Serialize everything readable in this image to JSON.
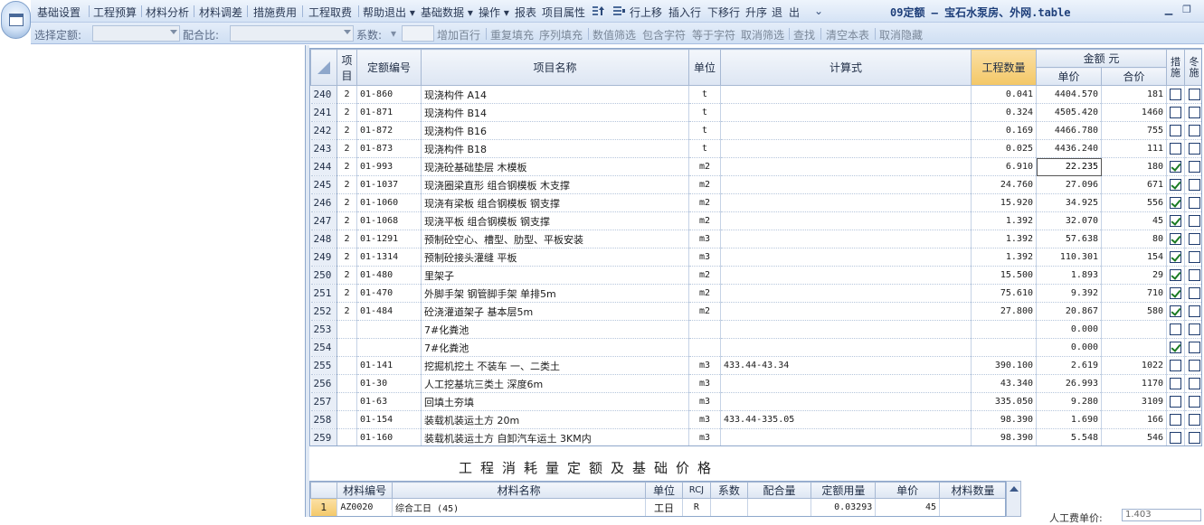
{
  "window_title": "09定额 — 宝石水泵房、外网.table",
  "menu": [
    "基础设置",
    "工程预算",
    "材料分析",
    "材料调差",
    "措施费用",
    "工程取费",
    "帮助退出 ▾",
    "基础数据 ▾",
    "操作 ▾",
    "报表",
    "项目属性",
    "行上移",
    "插入行",
    "下移行",
    "升序",
    "退",
    "出"
  ],
  "filterbar": {
    "select_quota_label": "选择定额:",
    "mix_ratio_label": "配合比:",
    "coef_label": "系数:",
    "actions": [
      "增加百行",
      "重复填充",
      "序列填充",
      "数值筛选",
      "包含字符",
      "等于字符",
      "取消筛选",
      "查找",
      "清空本表",
      "取消隐藏"
    ]
  },
  "grid": {
    "headers": {
      "item": "项目",
      "code": "定额编号",
      "name": "项目名称",
      "unit": "单位",
      "formula": "计算式",
      "qty": "工程数量",
      "amount": "金额 元",
      "unit_price": "单价",
      "total": "合价",
      "measure": "措施",
      "winter": "冬施"
    },
    "rows": [
      {
        "no": "240",
        "item": "2",
        "code": "01-860",
        "name": "现浇构件 A14",
        "unit": "t",
        "formula": "",
        "qty": "0.041",
        "price": "4404.570",
        "total": "181",
        "measure": false,
        "winter": false
      },
      {
        "no": "241",
        "item": "2",
        "code": "01-871",
        "name": "现浇构件 B14",
        "unit": "t",
        "formula": "",
        "qty": "0.324",
        "price": "4505.420",
        "total": "1460",
        "measure": false,
        "winter": false
      },
      {
        "no": "242",
        "item": "2",
        "code": "01-872",
        "name": "现浇构件 B16",
        "unit": "t",
        "formula": "",
        "qty": "0.169",
        "price": "4466.780",
        "total": "755",
        "measure": false,
        "winter": false
      },
      {
        "no": "243",
        "item": "2",
        "code": "01-873",
        "name": "现浇构件 B18",
        "unit": "t",
        "formula": "",
        "qty": "0.025",
        "price": "4436.240",
        "total": "111",
        "measure": false,
        "winter": false
      },
      {
        "no": "244",
        "item": "2",
        "code": "01-993",
        "name": "现浇砼基础垫层 木模板",
        "unit": "m2",
        "formula": "",
        "qty": "6.910",
        "price": "22.235",
        "total": "180",
        "measure": true,
        "winter": false,
        "selected": true
      },
      {
        "no": "245",
        "item": "2",
        "code": "01-1037",
        "name": "现浇圈梁直形 组合钢模板 木支撑",
        "unit": "m2",
        "formula": "",
        "qty": "24.760",
        "price": "27.096",
        "total": "671",
        "measure": true,
        "winter": false
      },
      {
        "no": "246",
        "item": "2",
        "code": "01-1060",
        "name": "现浇有梁板 组合钢模板 钢支撑",
        "unit": "m2",
        "formula": "",
        "qty": "15.920",
        "price": "34.925",
        "total": "556",
        "measure": true,
        "winter": false
      },
      {
        "no": "247",
        "item": "2",
        "code": "01-1068",
        "name": "现浇平板 组合钢模板 钢支撑",
        "unit": "m2",
        "formula": "",
        "qty": "1.392",
        "price": "32.070",
        "total": "45",
        "measure": true,
        "winter": false
      },
      {
        "no": "248",
        "item": "2",
        "code": "01-1291",
        "name": "预制砼空心、槽型、肋型、平板安装",
        "unit": "m3",
        "formula": "",
        "qty": "1.392",
        "price": "57.638",
        "total": "80",
        "measure": true,
        "winter": false
      },
      {
        "no": "249",
        "item": "2",
        "code": "01-1314",
        "name": "预制砼接头灌缝 平板",
        "unit": "m3",
        "formula": "",
        "qty": "1.392",
        "price": "110.301",
        "total": "154",
        "measure": true,
        "winter": false
      },
      {
        "no": "250",
        "item": "2",
        "code": "01-480",
        "name": "里架子",
        "unit": "m2",
        "formula": "",
        "qty": "15.500",
        "price": "1.893",
        "total": "29",
        "measure": true,
        "winter": false
      },
      {
        "no": "251",
        "item": "2",
        "code": "01-470",
        "name": "外脚手架 钢管脚手架 单排5m",
        "unit": "m2",
        "formula": "",
        "qty": "75.610",
        "price": "9.392",
        "total": "710",
        "measure": true,
        "winter": false
      },
      {
        "no": "252",
        "item": "2",
        "code": "01-484",
        "name": "砼浇灌道架子 基本层5m",
        "unit": "m2",
        "formula": "",
        "qty": "27.800",
        "price": "20.867",
        "total": "580",
        "measure": true,
        "winter": false
      },
      {
        "no": "253",
        "item": "",
        "code": "",
        "name": "7#化粪池",
        "unit": "",
        "formula": "",
        "qty": "",
        "price": "0.000",
        "total": "",
        "measure": false,
        "winter": false
      },
      {
        "no": "254",
        "item": "",
        "code": "",
        "name": "7#化粪池",
        "unit": "",
        "formula": "",
        "qty": "",
        "price": "0.000",
        "total": "",
        "measure": true,
        "winter": false
      },
      {
        "no": "255",
        "item": "",
        "code": "01-141",
        "name": "挖掘机挖土 不装车 一、二类土",
        "unit": "m3",
        "formula": "433.44-43.34",
        "qty": "390.100",
        "price": "2.619",
        "total": "1022",
        "measure": false,
        "winter": false
      },
      {
        "no": "256",
        "item": "",
        "code": "01-30",
        "name": "人工挖基坑三类土 深度6m",
        "unit": "m3",
        "formula": "",
        "qty": "43.340",
        "price": "26.993",
        "total": "1170",
        "measure": false,
        "winter": false
      },
      {
        "no": "257",
        "item": "",
        "code": "01-63",
        "name": "回填土夯填",
        "unit": "m3",
        "formula": "",
        "qty": "335.050",
        "price": "9.280",
        "total": "3109",
        "measure": false,
        "winter": false
      },
      {
        "no": "258",
        "item": "",
        "code": "01-154",
        "name": "装载机装运土方 20m",
        "unit": "m3",
        "formula": "433.44-335.05",
        "qty": "98.390",
        "price": "1.690",
        "total": "166",
        "measure": false,
        "winter": false
      },
      {
        "no": "259",
        "item": "",
        "code": "01-160",
        "name": "装载机装运土方 自卸汽车运土 3KM内",
        "unit": "m3",
        "formula": "",
        "qty": "98.390",
        "price": "5.548",
        "total": "546",
        "measure": false,
        "winter": false
      }
    ]
  },
  "sub_section": {
    "title": "工程消耗量定额及基础价格",
    "headers": [
      "材料编号",
      "材料名称",
      "单位",
      "RCJ",
      "系数",
      "配合量",
      "定额用量",
      "单价",
      "材料数量"
    ],
    "rows": [
      {
        "no": "1",
        "code": "AZ0020",
        "name": "综合工日 (45)",
        "unit": "工日",
        "rcj": "R",
        "coef": "",
        "mix": "",
        "usage": "0.03293",
        "price": "45",
        "qty": ""
      }
    ],
    "side_label": "人工费单价:",
    "side_value": "1.403"
  }
}
